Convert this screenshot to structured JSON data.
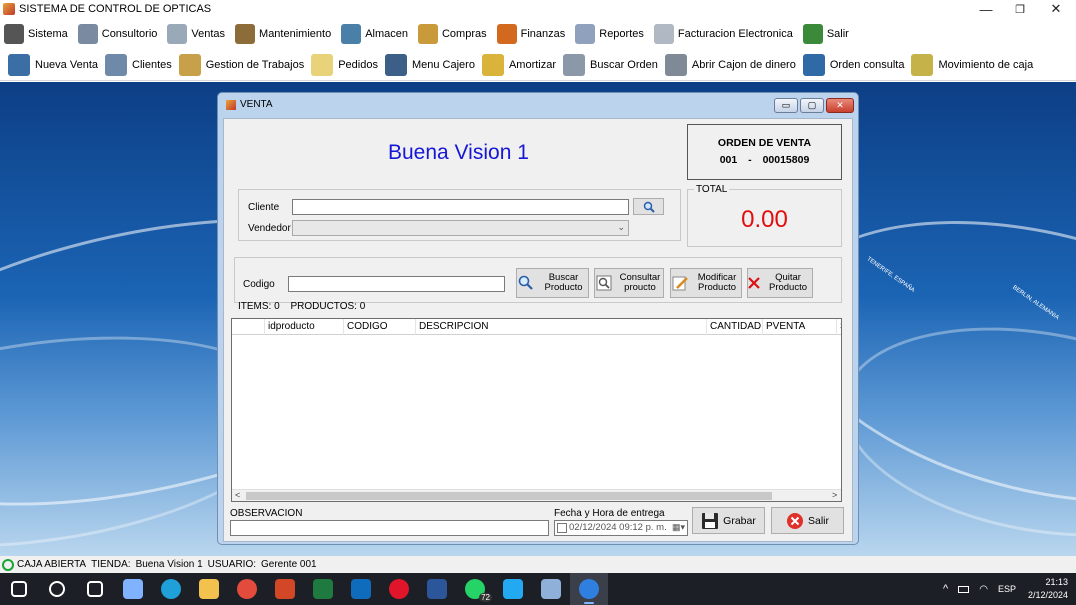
{
  "window": {
    "title": "SISTEMA DE CONTROL DE OPTICAS",
    "minimize": "—",
    "restore": "❐",
    "close": "✕"
  },
  "menu": [
    {
      "label": "Sistema",
      "icon": "gears-icon",
      "color": "#555555"
    },
    {
      "label": "Consultorio",
      "icon": "doctor-icon",
      "color": "#7a8aa0"
    },
    {
      "label": "Ventas",
      "icon": "hand-cart-icon",
      "color": "#9aa9b8"
    },
    {
      "label": "Mantenimiento",
      "icon": "tools-icon",
      "color": "#8c6d3a"
    },
    {
      "label": "Almacen",
      "icon": "house-icon",
      "color": "#4a7fa8"
    },
    {
      "label": "Compras",
      "icon": "boxes-icon",
      "color": "#c99a3a"
    },
    {
      "label": "Finanzas",
      "icon": "bar-chart-icon",
      "color": "#d2691e"
    },
    {
      "label": "Reportes",
      "icon": "report-icon",
      "color": "#8fa1bd"
    },
    {
      "label": "Facturacion Electronica",
      "icon": "invoice-icon",
      "color": "#b0b8c4"
    },
    {
      "label": "Salir",
      "icon": "exit-door-icon",
      "color": "#3a8a3a"
    }
  ],
  "toolbar": [
    {
      "label": "Nueva Venta",
      "icon": "cart-icon",
      "color": "#3a6ea5"
    },
    {
      "label": "Clientes",
      "icon": "users-icon",
      "color": "#6f8aa8"
    },
    {
      "label": "Gestion de Trabajos",
      "icon": "clipboard-icon",
      "color": "#c8a04a"
    },
    {
      "label": "Pedidos",
      "icon": "notepad-icon",
      "color": "#e8d27a"
    },
    {
      "label": "Menu Cajero",
      "icon": "monitor-icon",
      "color": "#3b5f86"
    },
    {
      "label": "Amortizar",
      "icon": "coins-icon",
      "color": "#d9b33a"
    },
    {
      "label": "Buscar Orden",
      "icon": "search-doc-icon",
      "color": "#8b98a8"
    },
    {
      "label": "Abrir Cajon de dinero",
      "icon": "cash-register-icon",
      "color": "#7f8a96"
    },
    {
      "label": "Orden consulta",
      "icon": "patient-icon",
      "color": "#2f6aa6"
    },
    {
      "label": "Movimiento de caja",
      "icon": "money-icon",
      "color": "#c5b34a"
    }
  ],
  "dialog": {
    "title": "VENTA",
    "store_name": "Buena Vision 1",
    "order": {
      "heading": "ORDEN DE VENTA",
      "series": "001",
      "separator": "-",
      "number": "00015809"
    },
    "total": {
      "label": "TOTAL",
      "value": "0.00"
    },
    "cliente_label": "Cliente",
    "cliente_value": "",
    "vendedor_label": "Vendedor",
    "vendedor_value": "",
    "codigo_label": "Codigo",
    "codigo_value": "",
    "buttons": {
      "buscar_producto": "Buscar Producto",
      "consultar_producto": "Consultar proucto",
      "modificar_producto": "Modificar Producto",
      "quitar_producto": "Quitar Producto",
      "grabar": "Grabar",
      "salir": "Salir"
    },
    "counts": {
      "items_label": "ITEMS:",
      "items": "0",
      "productos_label": "PRODUCTOS:",
      "productos": "0"
    },
    "grid_columns": [
      "",
      "idproducto",
      "CODIGO",
      "DESCRIPCION",
      "CANTIDAD",
      "PVENTA",
      "S"
    ],
    "observacion_label": "OBSERVACION",
    "observacion_value": "",
    "fecha_label": "Fecha y Hora de entrega",
    "fecha_value": "02/12/2024 09:12 p. m."
  },
  "status": {
    "caja": "CAJA ABIERTA",
    "tienda_label": "TIENDA:",
    "tienda": "Buena Vision 1",
    "usuario_label": "USUARIO:",
    "usuario": "Gerente  001"
  },
  "desktop_text": {
    "a": "TENERIFE, ESPAÑA",
    "b": "BERLIN, ALEMANIA"
  },
  "taskbar": {
    "apps": [
      {
        "icon": "windows-start-icon",
        "color": "#ffffff"
      },
      {
        "icon": "search-icon",
        "color": "#ffffff"
      },
      {
        "icon": "task-view-icon",
        "color": "#ffffff"
      },
      {
        "icon": "copilot-icon",
        "color": "#7fb2ff"
      },
      {
        "icon": "edge-icon",
        "color": "#1fa0d8"
      },
      {
        "icon": "file-explorer-icon",
        "color": "#f2c14e"
      },
      {
        "icon": "chrome-icon",
        "color": "#e34b3c"
      },
      {
        "icon": "powerpoint-icon",
        "color": "#d24726"
      },
      {
        "icon": "excel-icon",
        "color": "#1f7a3f"
      },
      {
        "icon": "outlook-icon",
        "color": "#0f6cbd"
      },
      {
        "icon": "opera-icon",
        "color": "#e0152a"
      },
      {
        "icon": "word-icon",
        "color": "#2b579a"
      },
      {
        "icon": "whatsapp-icon",
        "color": "#25d366"
      },
      {
        "icon": "vscode-icon",
        "color": "#23a8f2"
      },
      {
        "icon": "notepad-app-icon",
        "color": "#8fb0d8"
      },
      {
        "icon": "optics-app-icon",
        "color": "#2f7fe0"
      }
    ],
    "whatsapp_badge": "72",
    "lang": "ESP",
    "time": "21:13",
    "date": "2/12/2024"
  }
}
